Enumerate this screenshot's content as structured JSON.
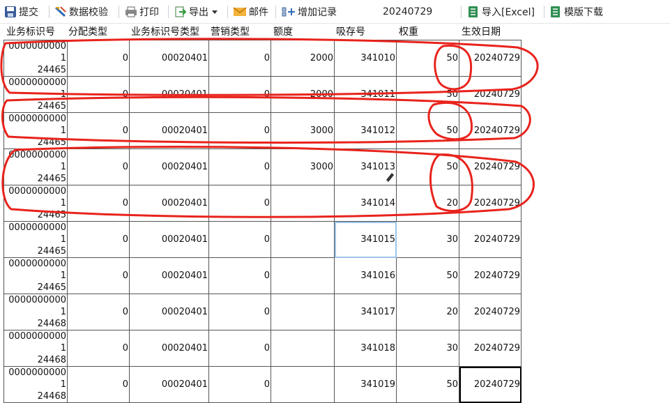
{
  "toolbar": {
    "submit_label": "提交",
    "validate_label": "数据校验",
    "print_label": "打印",
    "export_label": "导出",
    "mail_label": "邮件",
    "add_record_label": "增加记录",
    "date_value": "20240729",
    "import_label": "导入[Excel]",
    "template_label": "模版下载"
  },
  "columns": [
    "业务标识号",
    "分配类型",
    "业务标识号类型",
    "营销类型",
    "额度",
    "吸存号",
    "权重",
    "生效日期"
  ],
  "rows": [
    {
      "id_line1": "00000000001",
      "id_line2": "24465",
      "alloc_type": "0",
      "id_type": "00020401",
      "mkt_type": "0",
      "amount": "2000",
      "deposit_no": "341010",
      "weight": "50",
      "date": "20240729"
    },
    {
      "id_line1": "00000000001",
      "id_line2": "24465",
      "alloc_type": "0",
      "id_type": "00020401",
      "mkt_type": "0",
      "amount": "2000",
      "deposit_no": "341011",
      "weight": "50",
      "date": "20240729"
    },
    {
      "id_line1": "00000000001",
      "id_line2": "24465",
      "alloc_type": "0",
      "id_type": "00020401",
      "mkt_type": "0",
      "amount": "3000",
      "deposit_no": "341012",
      "weight": "50",
      "date": "20240729"
    },
    {
      "id_line1": "00000000001",
      "id_line2": "24465",
      "alloc_type": "0",
      "id_type": "00020401",
      "mkt_type": "0",
      "amount": "3000",
      "deposit_no": "341013",
      "weight": "50",
      "date": "20240729"
    },
    {
      "id_line1": "00000000001",
      "id_line2": "24465",
      "alloc_type": "0",
      "id_type": "00020401",
      "mkt_type": "0",
      "amount": "",
      "deposit_no": "341014",
      "weight": "20",
      "date": "20240729"
    },
    {
      "id_line1": "00000000001",
      "id_line2": "24465",
      "alloc_type": "0",
      "id_type": "00020401",
      "mkt_type": "0",
      "amount": "",
      "deposit_no": "341015",
      "weight": "30",
      "date": "20240729"
    },
    {
      "id_line1": "00000000001",
      "id_line2": "24465",
      "alloc_type": "0",
      "id_type": "00020401",
      "mkt_type": "0",
      "amount": "",
      "deposit_no": "341016",
      "weight": "50",
      "date": "20240729"
    },
    {
      "id_line1": "00000000001",
      "id_line2": "24468",
      "alloc_type": "0",
      "id_type": "00020401",
      "mkt_type": "0",
      "amount": "",
      "deposit_no": "341017",
      "weight": "20",
      "date": "20240729"
    },
    {
      "id_line1": "00000000001",
      "id_line2": "24468",
      "alloc_type": "0",
      "id_type": "00020401",
      "mkt_type": "0",
      "amount": "",
      "deposit_no": "341018",
      "weight": "30",
      "date": "20240729"
    },
    {
      "id_line1": "00000000001",
      "id_line2": "24468",
      "alloc_type": "0",
      "id_type": "00020401",
      "mkt_type": "0",
      "amount": "",
      "deposit_no": "341019",
      "weight": "50",
      "date": "20240729"
    }
  ],
  "colors": {
    "annotation_red": "#e8231c",
    "selected_cell_border": "#9cc3ea",
    "active_cell_border": "#000000",
    "excel_green": "#2f8f52"
  },
  "icons": [
    "save-icon",
    "ruler-pencil-icon",
    "printer-icon",
    "export-icon",
    "mail-icon",
    "add-record-icon",
    "excel-import-icon",
    "excel-template-icon",
    "pencil-cursor-icon"
  ]
}
